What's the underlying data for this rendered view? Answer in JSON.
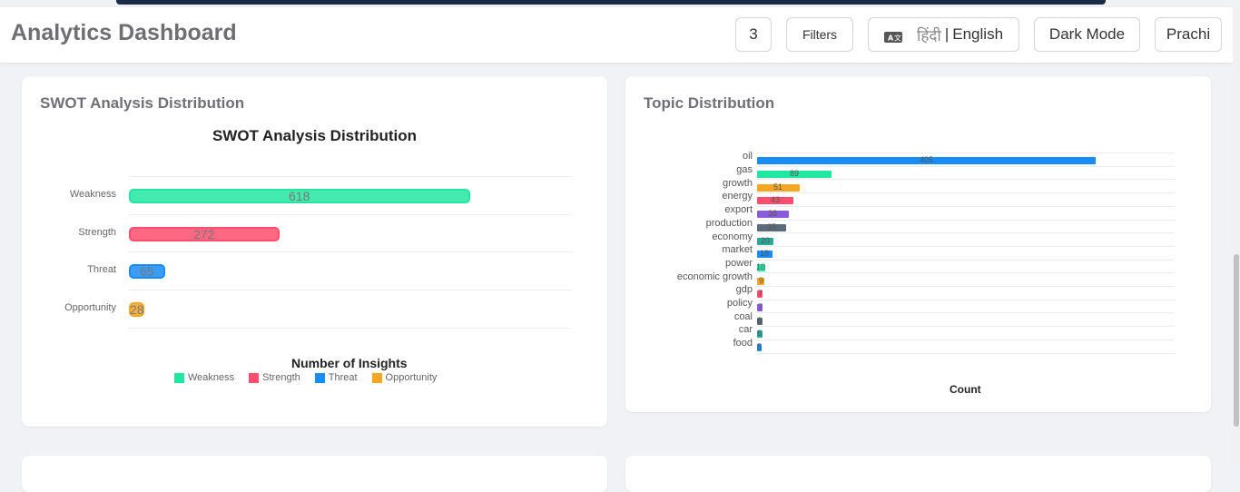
{
  "header": {
    "title": "Analytics Dashboard",
    "count_badge": "3",
    "filters_label": "Filters",
    "language_hindi": "हिंदी",
    "language_separator": "|",
    "language_english": "English",
    "dark_mode_label": "Dark Mode",
    "user_label": "Prachi"
  },
  "swot_card": {
    "title": "SWOT Analysis Distribution"
  },
  "topic_card": {
    "title": "Topic Distribution"
  },
  "chart_data": [
    {
      "type": "bar",
      "orientation": "horizontal",
      "title": "SWOT Analysis Distribution",
      "xlabel": "Number of Insights",
      "ylabel": "",
      "categories": [
        "Weakness",
        "Strength",
        "Threat",
        "Opportunity"
      ],
      "values": [
        618,
        272,
        65,
        28
      ],
      "colors": [
        "#23e6a1",
        "#ff4d6d",
        "#1a8cf5",
        "#f5a623"
      ],
      "xlim": [
        0,
        800
      ],
      "legend": "bottom",
      "grid": true
    },
    {
      "type": "bar",
      "orientation": "horizontal",
      "title": "",
      "xlabel": "Count",
      "ylabel": "",
      "categories": [
        "oil",
        "gas",
        "growth",
        "energy",
        "export",
        "production",
        "economy",
        "market",
        "power",
        "economic growth",
        "gdp",
        "policy",
        "coal",
        "car",
        "food"
      ],
      "values": [
        405,
        89,
        51,
        43,
        38,
        35,
        20,
        18,
        10,
        9,
        7,
        7,
        6,
        6,
        5
      ],
      "colors": [
        "#1a8cf5",
        "#23e6a1",
        "#f5a623",
        "#ff4d6d",
        "#8a5cdb",
        "#5b6b7c",
        "#2aa89a",
        "#1a8cf5",
        "#23e6a1",
        "#f5a623",
        "#ff4d6d",
        "#8a5cdb",
        "#5b6b7c",
        "#2aa89a",
        "#1a8cf5"
      ],
      "xlim": [
        0,
        500
      ],
      "grid": true
    }
  ]
}
